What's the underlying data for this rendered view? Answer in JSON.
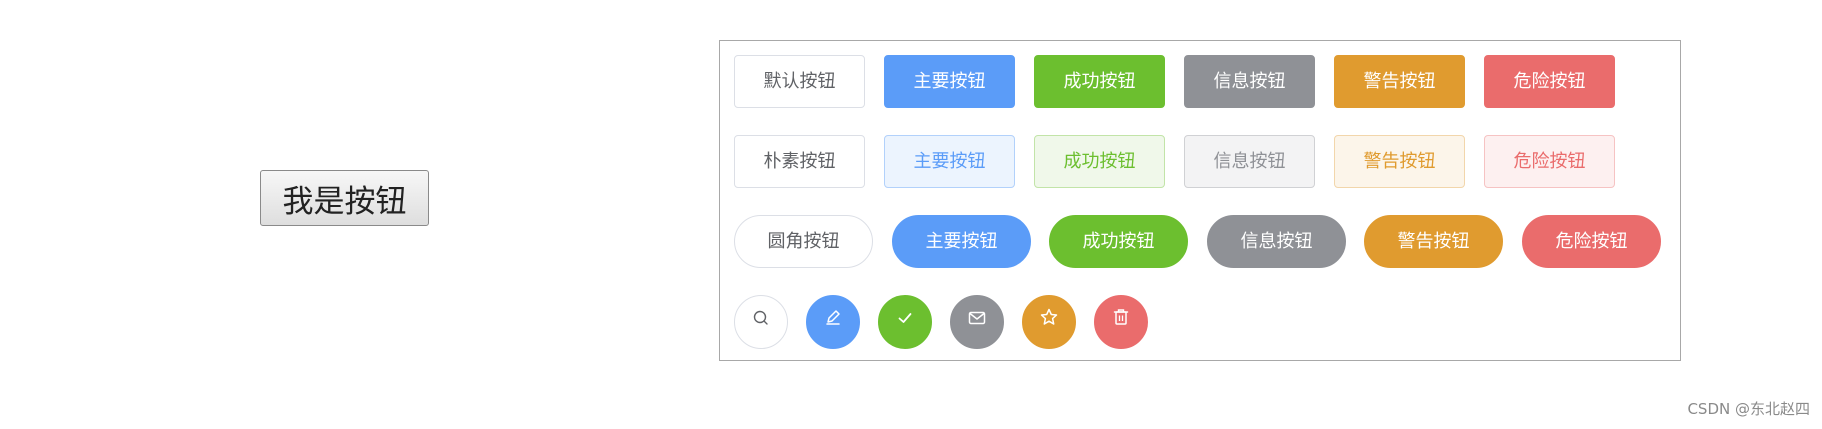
{
  "native_button": {
    "label": "我是按钮"
  },
  "rows": {
    "normal": {
      "default": "默认按钮",
      "primary": "主要按钮",
      "success": "成功按钮",
      "info": "信息按钮",
      "warning": "警告按钮",
      "danger": "危险按钮"
    },
    "plain": {
      "default": "朴素按钮",
      "primary": "主要按钮",
      "success": "成功按钮",
      "info": "信息按钮",
      "warning": "警告按钮",
      "danger": "危险按钮"
    },
    "round": {
      "default": "圆角按钮",
      "primary": "主要按钮",
      "success": "成功按钮",
      "info": "信息按钮",
      "warning": "警告按钮",
      "danger": "危险按钮"
    }
  },
  "icon_buttons": [
    "search-icon",
    "edit-icon",
    "check-icon",
    "message-icon",
    "star-icon",
    "delete-icon"
  ],
  "colors": {
    "primary": "#5b9cf8",
    "success": "#6cbf2f",
    "info": "#8f9196",
    "warning": "#e09b2f",
    "danger": "#ea6c6c"
  },
  "watermark": "CSDN @东北赵四"
}
